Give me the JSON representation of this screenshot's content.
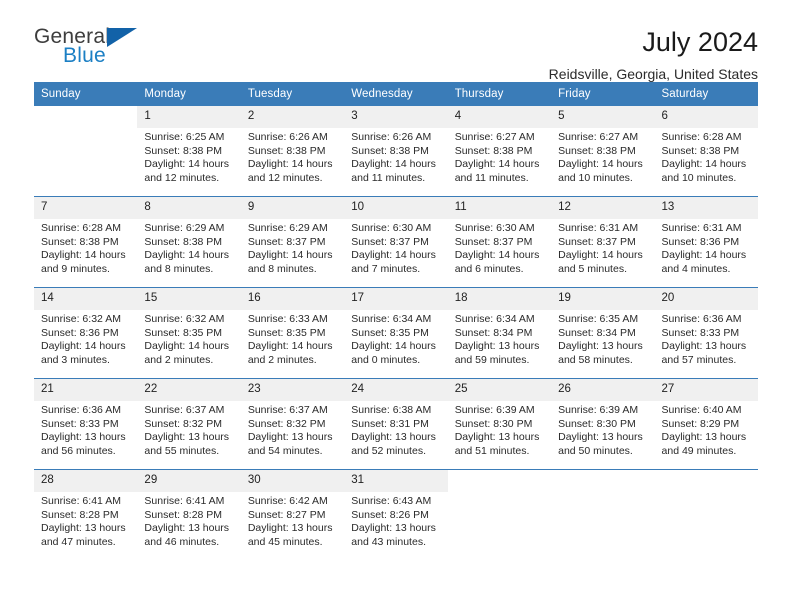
{
  "brand": {
    "name_part1": "General",
    "name_part2": "Blue",
    "triangle_icon": "triangle-icon",
    "accent_color": "#1b7fc4",
    "triangle_color": "#1262a8"
  },
  "header": {
    "title": "July 2024",
    "location": "Reidsville, Georgia, United States",
    "header_bg_color": "#3a7cb8",
    "daynum_bg_color": "#f0f0f0"
  },
  "weekday_headers": [
    "Sunday",
    "Monday",
    "Tuesday",
    "Wednesday",
    "Thursday",
    "Friday",
    "Saturday"
  ],
  "labels": {
    "sunrise_prefix": "Sunrise:",
    "sunset_prefix": "Sunset:",
    "daylight_prefix": "Daylight:"
  },
  "weeks": [
    [
      {
        "day": "",
        "empty": true
      },
      {
        "day": "1",
        "sunrise": "Sunrise: 6:25 AM",
        "sunset": "Sunset: 8:38 PM",
        "daylight_line1": "Daylight: 14 hours",
        "daylight_line2": "and 12 minutes."
      },
      {
        "day": "2",
        "sunrise": "Sunrise: 6:26 AM",
        "sunset": "Sunset: 8:38 PM",
        "daylight_line1": "Daylight: 14 hours",
        "daylight_line2": "and 12 minutes."
      },
      {
        "day": "3",
        "sunrise": "Sunrise: 6:26 AM",
        "sunset": "Sunset: 8:38 PM",
        "daylight_line1": "Daylight: 14 hours",
        "daylight_line2": "and 11 minutes."
      },
      {
        "day": "4",
        "sunrise": "Sunrise: 6:27 AM",
        "sunset": "Sunset: 8:38 PM",
        "daylight_line1": "Daylight: 14 hours",
        "daylight_line2": "and 11 minutes."
      },
      {
        "day": "5",
        "sunrise": "Sunrise: 6:27 AM",
        "sunset": "Sunset: 8:38 PM",
        "daylight_line1": "Daylight: 14 hours",
        "daylight_line2": "and 10 minutes."
      },
      {
        "day": "6",
        "sunrise": "Sunrise: 6:28 AM",
        "sunset": "Sunset: 8:38 PM",
        "daylight_line1": "Daylight: 14 hours",
        "daylight_line2": "and 10 minutes."
      }
    ],
    [
      {
        "day": "7",
        "sunrise": "Sunrise: 6:28 AM",
        "sunset": "Sunset: 8:38 PM",
        "daylight_line1": "Daylight: 14 hours",
        "daylight_line2": "and 9 minutes."
      },
      {
        "day": "8",
        "sunrise": "Sunrise: 6:29 AM",
        "sunset": "Sunset: 8:38 PM",
        "daylight_line1": "Daylight: 14 hours",
        "daylight_line2": "and 8 minutes."
      },
      {
        "day": "9",
        "sunrise": "Sunrise: 6:29 AM",
        "sunset": "Sunset: 8:37 PM",
        "daylight_line1": "Daylight: 14 hours",
        "daylight_line2": "and 8 minutes."
      },
      {
        "day": "10",
        "sunrise": "Sunrise: 6:30 AM",
        "sunset": "Sunset: 8:37 PM",
        "daylight_line1": "Daylight: 14 hours",
        "daylight_line2": "and 7 minutes."
      },
      {
        "day": "11",
        "sunrise": "Sunrise: 6:30 AM",
        "sunset": "Sunset: 8:37 PM",
        "daylight_line1": "Daylight: 14 hours",
        "daylight_line2": "and 6 minutes."
      },
      {
        "day": "12",
        "sunrise": "Sunrise: 6:31 AM",
        "sunset": "Sunset: 8:37 PM",
        "daylight_line1": "Daylight: 14 hours",
        "daylight_line2": "and 5 minutes."
      },
      {
        "day": "13",
        "sunrise": "Sunrise: 6:31 AM",
        "sunset": "Sunset: 8:36 PM",
        "daylight_line1": "Daylight: 14 hours",
        "daylight_line2": "and 4 minutes."
      }
    ],
    [
      {
        "day": "14",
        "sunrise": "Sunrise: 6:32 AM",
        "sunset": "Sunset: 8:36 PM",
        "daylight_line1": "Daylight: 14 hours",
        "daylight_line2": "and 3 minutes."
      },
      {
        "day": "15",
        "sunrise": "Sunrise: 6:32 AM",
        "sunset": "Sunset: 8:35 PM",
        "daylight_line1": "Daylight: 14 hours",
        "daylight_line2": "and 2 minutes."
      },
      {
        "day": "16",
        "sunrise": "Sunrise: 6:33 AM",
        "sunset": "Sunset: 8:35 PM",
        "daylight_line1": "Daylight: 14 hours",
        "daylight_line2": "and 2 minutes."
      },
      {
        "day": "17",
        "sunrise": "Sunrise: 6:34 AM",
        "sunset": "Sunset: 8:35 PM",
        "daylight_line1": "Daylight: 14 hours",
        "daylight_line2": "and 0 minutes."
      },
      {
        "day": "18",
        "sunrise": "Sunrise: 6:34 AM",
        "sunset": "Sunset: 8:34 PM",
        "daylight_line1": "Daylight: 13 hours",
        "daylight_line2": "and 59 minutes."
      },
      {
        "day": "19",
        "sunrise": "Sunrise: 6:35 AM",
        "sunset": "Sunset: 8:34 PM",
        "daylight_line1": "Daylight: 13 hours",
        "daylight_line2": "and 58 minutes."
      },
      {
        "day": "20",
        "sunrise": "Sunrise: 6:36 AM",
        "sunset": "Sunset: 8:33 PM",
        "daylight_line1": "Daylight: 13 hours",
        "daylight_line2": "and 57 minutes."
      }
    ],
    [
      {
        "day": "21",
        "sunrise": "Sunrise: 6:36 AM",
        "sunset": "Sunset: 8:33 PM",
        "daylight_line1": "Daylight: 13 hours",
        "daylight_line2": "and 56 minutes."
      },
      {
        "day": "22",
        "sunrise": "Sunrise: 6:37 AM",
        "sunset": "Sunset: 8:32 PM",
        "daylight_line1": "Daylight: 13 hours",
        "daylight_line2": "and 55 minutes."
      },
      {
        "day": "23",
        "sunrise": "Sunrise: 6:37 AM",
        "sunset": "Sunset: 8:32 PM",
        "daylight_line1": "Daylight: 13 hours",
        "daylight_line2": "and 54 minutes."
      },
      {
        "day": "24",
        "sunrise": "Sunrise: 6:38 AM",
        "sunset": "Sunset: 8:31 PM",
        "daylight_line1": "Daylight: 13 hours",
        "daylight_line2": "and 52 minutes."
      },
      {
        "day": "25",
        "sunrise": "Sunrise: 6:39 AM",
        "sunset": "Sunset: 8:30 PM",
        "daylight_line1": "Daylight: 13 hours",
        "daylight_line2": "and 51 minutes."
      },
      {
        "day": "26",
        "sunrise": "Sunrise: 6:39 AM",
        "sunset": "Sunset: 8:30 PM",
        "daylight_line1": "Daylight: 13 hours",
        "daylight_line2": "and 50 minutes."
      },
      {
        "day": "27",
        "sunrise": "Sunrise: 6:40 AM",
        "sunset": "Sunset: 8:29 PM",
        "daylight_line1": "Daylight: 13 hours",
        "daylight_line2": "and 49 minutes."
      }
    ],
    [
      {
        "day": "28",
        "sunrise": "Sunrise: 6:41 AM",
        "sunset": "Sunset: 8:28 PM",
        "daylight_line1": "Daylight: 13 hours",
        "daylight_line2": "and 47 minutes."
      },
      {
        "day": "29",
        "sunrise": "Sunrise: 6:41 AM",
        "sunset": "Sunset: 8:28 PM",
        "daylight_line1": "Daylight: 13 hours",
        "daylight_line2": "and 46 minutes."
      },
      {
        "day": "30",
        "sunrise": "Sunrise: 6:42 AM",
        "sunset": "Sunset: 8:27 PM",
        "daylight_line1": "Daylight: 13 hours",
        "daylight_line2": "and 45 minutes."
      },
      {
        "day": "31",
        "sunrise": "Sunrise: 6:43 AM",
        "sunset": "Sunset: 8:26 PM",
        "daylight_line1": "Daylight: 13 hours",
        "daylight_line2": "and 43 minutes."
      },
      {
        "day": "",
        "empty": true
      },
      {
        "day": "",
        "empty": true
      },
      {
        "day": "",
        "empty": true
      }
    ]
  ]
}
